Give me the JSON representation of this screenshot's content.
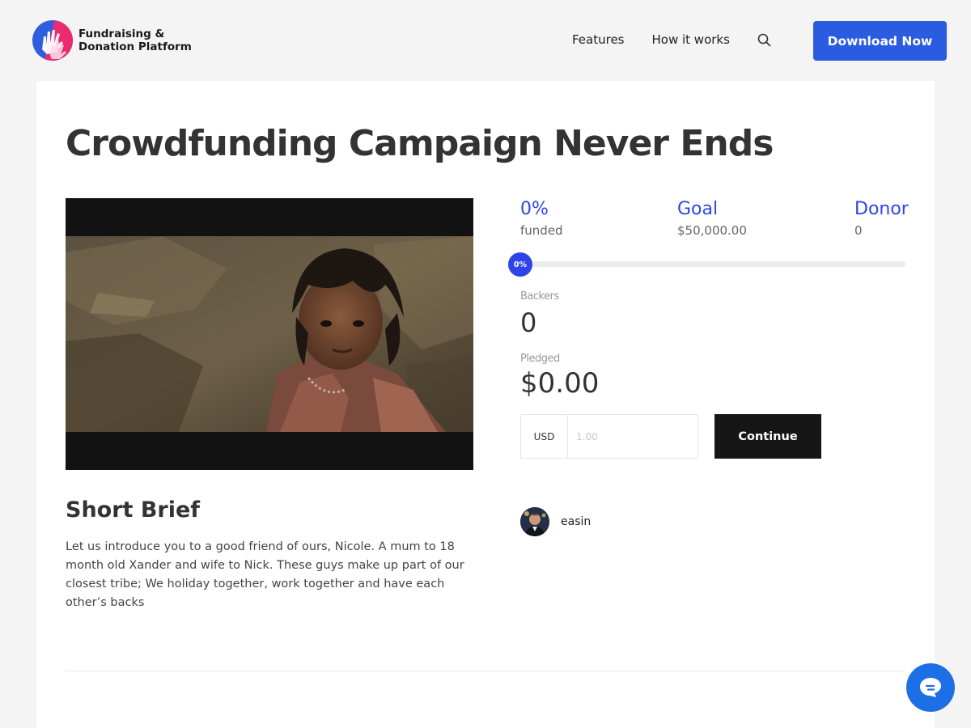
{
  "brand": {
    "line1": "Fundraising &",
    "line2": "Donation Platform",
    "colors": {
      "blue": "#2f5de0",
      "pink": "#ec2a6f"
    }
  },
  "nav": {
    "items": [
      "Features",
      "How it works"
    ],
    "search_icon": "search-icon",
    "cta_label": "Download Now",
    "cta_color": "#2a5be0"
  },
  "campaign": {
    "title": "Crowdfunding Campaign Never Ends",
    "image_icon": "campaign-photo",
    "funded": {
      "value": "0%",
      "label": "funded"
    },
    "goal": {
      "label": "Goal",
      "value": "$50,000.00"
    },
    "donor": {
      "label": "Donor",
      "value": "0"
    },
    "progress": {
      "percent": 0,
      "label": "0%"
    },
    "backers": {
      "label": "Backers",
      "value": "0"
    },
    "pledged": {
      "label": "Pledged",
      "value": "$0.00"
    },
    "accent_color": "#2f44e8"
  },
  "pledge_form": {
    "currency": "USD",
    "amount_placeholder": "1.00",
    "submit_label": "Continue"
  },
  "author": {
    "name": "easin",
    "avatar_icon": "avatar"
  },
  "brief": {
    "title": "Short Brief",
    "text": "Let us introduce you to a good friend of ours, Nicole. A mum to 18 month old Xander and wife to Nick. These guys make up part of our closest tribe; We holiday together, work together and have each other’s backs"
  },
  "chat": {
    "icon": "chat-icon",
    "color": "#1d6fe6"
  }
}
